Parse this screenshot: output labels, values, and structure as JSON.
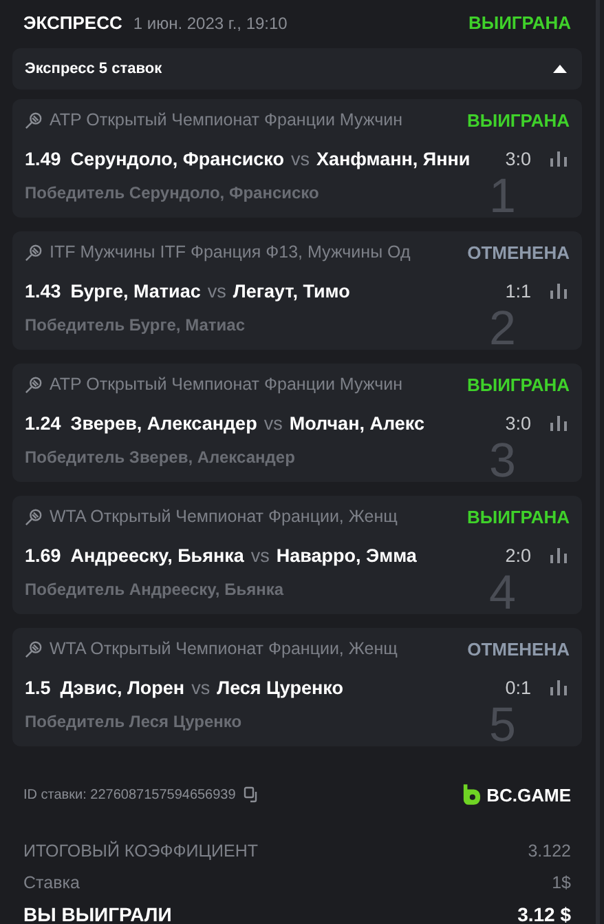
{
  "header": {
    "title": "ЭКСПРЕСС",
    "date": "1 июн. 2023 г., 19:10",
    "status": {
      "kind": "won",
      "label": "ВЫИГРАНА"
    }
  },
  "group": {
    "label": "Экспресс 5 ставок",
    "expanded": true
  },
  "bets": [
    {
      "index": "1",
      "tournament": "ATP Открытый Чемпионат Франции Мужчин",
      "status": {
        "kind": "won",
        "label": "ВЫИГРАНА"
      },
      "odds": "1.49",
      "home": "Серундоло, Франсиско",
      "vs": "vs",
      "away": "Ханфманн, Янни",
      "score": "3:0",
      "pick": "Победитель Серундоло, Франсиско"
    },
    {
      "index": "2",
      "tournament": "ITF Мужчины ITF Франция Ф13, Мужчины Од",
      "status": {
        "kind": "cancelled",
        "label": "ОТМЕНЕНА"
      },
      "odds": "1.43",
      "home": "Бурге, Матиас",
      "vs": "vs",
      "away": "Легаут, Тимо",
      "score": "1:1",
      "pick": "Победитель Бурге, Матиас"
    },
    {
      "index": "3",
      "tournament": "ATP Открытый Чемпионат Франции Мужчин",
      "status": {
        "kind": "won",
        "label": "ВЫИГРАНА"
      },
      "odds": "1.24",
      "home": "Зверев, Александер",
      "vs": "vs",
      "away": "Молчан, Алекс",
      "score": "3:0",
      "pick": "Победитель Зверев, Александер"
    },
    {
      "index": "4",
      "tournament": "WTA Открытый Чемпионат Франции, Женщ",
      "status": {
        "kind": "won",
        "label": "ВЫИГРАНА"
      },
      "odds": "1.69",
      "home": "Андрееску, Бьянка",
      "vs": "vs",
      "away": "Наварро, Эмма",
      "score": "2:0",
      "pick": "Победитель Андрееску, Бьянка"
    },
    {
      "index": "5",
      "tournament": "WTA Открытый Чемпионат Франции, Женщ",
      "status": {
        "kind": "cancelled",
        "label": "ОТМЕНЕНА"
      },
      "odds": "1.5",
      "home": "Дэвис, Лорен",
      "vs": "vs",
      "away": "Леся Цуренко",
      "score": "0:1",
      "pick": "Победитель Леся Цуренко"
    }
  ],
  "bet_id": "ID ставки: 2276087157594656939",
  "brand": "BC.GAME",
  "summary": [
    {
      "kind": "muted",
      "label": "ИТОГОВЫЙ КОЭФФИЦИЕНТ",
      "value": "3.122"
    },
    {
      "kind": "muted",
      "label": "Ставка",
      "value": "1$"
    },
    {
      "kind": "total",
      "label": "ВЫ ВЫИГРАЛИ",
      "value": "3.12 $"
    }
  ]
}
